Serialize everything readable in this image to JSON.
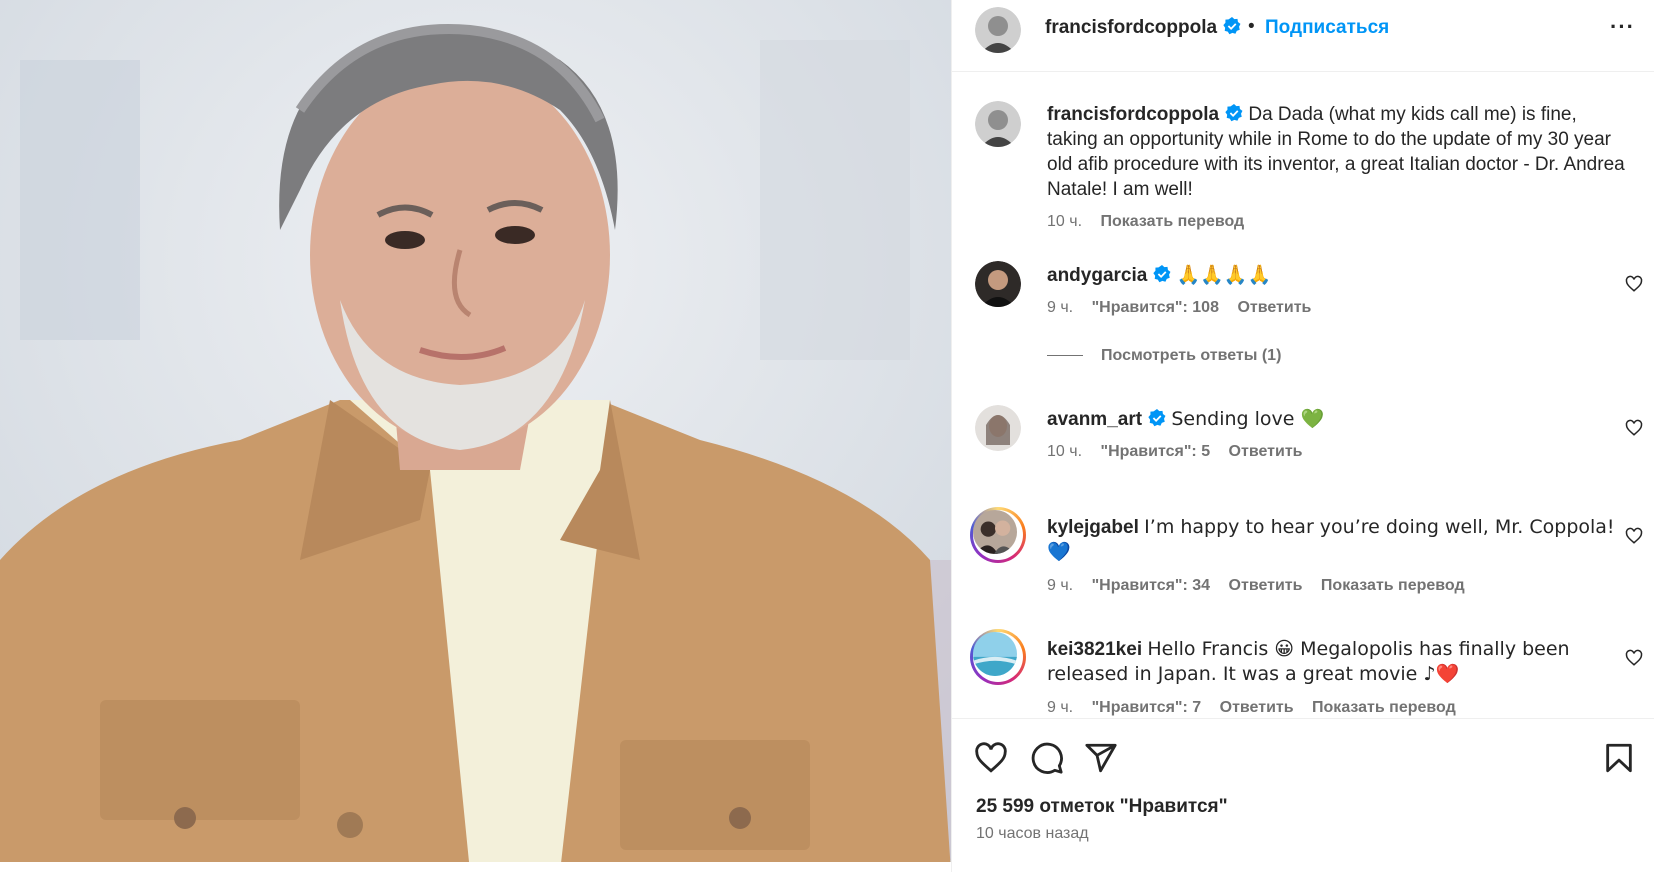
{
  "post": {
    "username": "francisfordcoppola",
    "separator": "•",
    "follow_label": "Подписаться",
    "more_label": "···",
    "caption": "Da Dada (what my kids call me) is fine, taking an opportunity while in Rome to do the update of my 30 year old afib procedure with its inventor, a great Italian doctor - Dr. Andrea Natale! I am well!",
    "caption_time": "10 ч.",
    "caption_translate": "Показать перевод",
    "likes_label": "25 599 отметок \"Нравится\"",
    "posted_ago": "10 часов назад"
  },
  "comments": [
    {
      "username": "andygarcia",
      "verified": true,
      "text": "🙏🙏🙏🙏",
      "time": "9 ч.",
      "likes": "\"Нравится\": 108",
      "reply": "Ответить",
      "view_replies": "Посмотреть ответы (1)"
    },
    {
      "username": "avanm_art",
      "verified": true,
      "text": "Sending love 💚",
      "time": "10 ч.",
      "likes": "\"Нравится\": 5",
      "reply": "Ответить"
    },
    {
      "username": "kylejgabel",
      "verified": false,
      "text": "I’m happy to hear you’re doing well, Mr. Coppola! 💙",
      "time": "9 ч.",
      "likes": "\"Нравится\": 34",
      "reply": "Ответить",
      "translate": "Показать перевод"
    },
    {
      "username": "kei3821kei",
      "verified": false,
      "text": "Hello Francis 😀 Megalopolis has finally been released in Japan. It was a great movie ♪❤️",
      "time": "9 ч.",
      "likes": "\"Нравится\": 7",
      "reply": "Ответить",
      "translate": "Показать перевод"
    }
  ],
  "icons": [
    "heart-icon",
    "comment-icon",
    "share-icon",
    "bookmark-icon",
    "verified-icon",
    "more-icon"
  ],
  "colors": {
    "accent": "#0095f6",
    "text": "#262626",
    "secondary": "#737373",
    "divider": "#efefef",
    "jacket": "#c99a6a"
  }
}
